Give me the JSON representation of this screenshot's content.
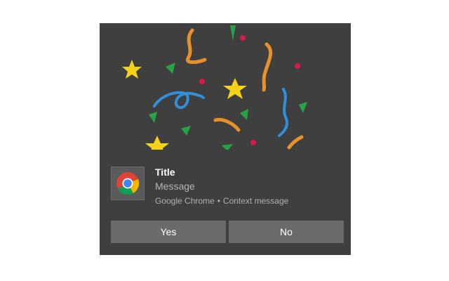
{
  "notification": {
    "title": "Title",
    "message": "Message",
    "app_name": "Google Chrome",
    "separator": "•",
    "context_message": "Context message",
    "app_icon": "chrome-logo-icon",
    "hero_image": "confetti-celebration-image",
    "actions": [
      {
        "label": "Yes"
      },
      {
        "label": "No"
      }
    ]
  },
  "colors": {
    "toast_background": "#3f3f3f",
    "button_background": "#6b6b6b",
    "title_text": "#ffffff",
    "secondary_text": "#b5b5b5"
  }
}
